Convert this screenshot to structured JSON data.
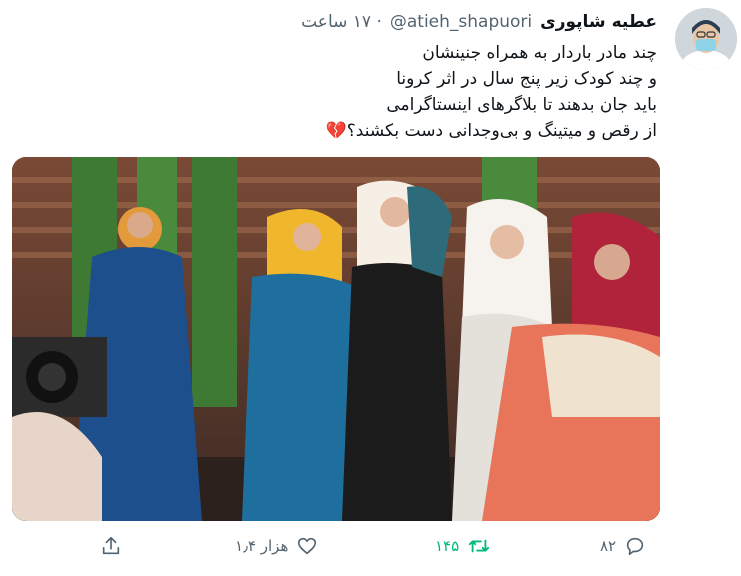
{
  "tweet": {
    "author_name": "عطیه شاپوری",
    "handle": "@atieh_shapuori",
    "time": "· ۱۷ ساعت",
    "text_lines": [
      "چند مادر باردار به همراه جنینشان",
      "و چند کودک زیر پنج سال در اثر کرونا",
      "باید جان بدهند تا بلاگرهای اینستاگرامی",
      "از رقص و میتینگ و بی‌وجدانی دست بکشند؟💔"
    ],
    "media_description": "photo of women in colorful headscarves dancing",
    "replies": "۸۲",
    "retweets": "۱۴۵",
    "likes": "۱٫۴ هزار"
  },
  "icons": {
    "reply": "reply-icon",
    "retweet": "retweet-icon",
    "like": "heart-icon",
    "share": "share-icon"
  },
  "colors": {
    "retweet_active": "#00ba7c",
    "secondary_text": "#536471"
  }
}
